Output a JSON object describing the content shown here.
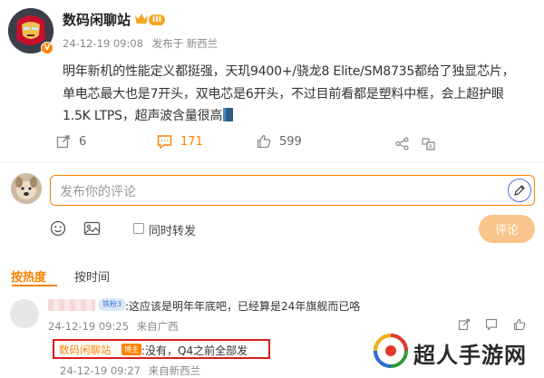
{
  "post": {
    "username": "数码闲聊站",
    "level": "III",
    "timestamp": "24-12-19 09:08",
    "location": "发布于 新西兰",
    "lines": [
      "明年新机的性能定义都挺强，天玑9400+/骁龙8 Elite/SM8735都给了独显芯片，",
      "单电芯最大也是7开头，双电芯是6开头，不过目前看都是塑料中框，会上超护眼",
      "1.5K LTPS，超声波含量很高"
    ]
  },
  "actions": {
    "repost_count": "6",
    "comment_count": "171",
    "like_count": "599"
  },
  "composer": {
    "placeholder": "发布你的评论",
    "repost_label": "同时转发",
    "submit_label": "评论"
  },
  "sort": {
    "hot": "按热度",
    "time": "按时间"
  },
  "comment": {
    "fan_badge": "铁粉3",
    "text": ":这应该是明年年底吧，已经算是24年旗舰而已咯",
    "timestamp": "24-12-19 09:25",
    "location": "来自广西"
  },
  "reply": {
    "name": "数码闲聊站",
    "author_badge": "博主",
    "text": ":没有，Q4之前全部发",
    "timestamp": "24-12-19 09:27",
    "location": "来自新西兰"
  },
  "watermark": {
    "text": "超人手游网"
  },
  "colors": {
    "accent": "#ff8200",
    "highlight_border": "#d81e1e",
    "submit_disabled": "#f9c58a"
  }
}
